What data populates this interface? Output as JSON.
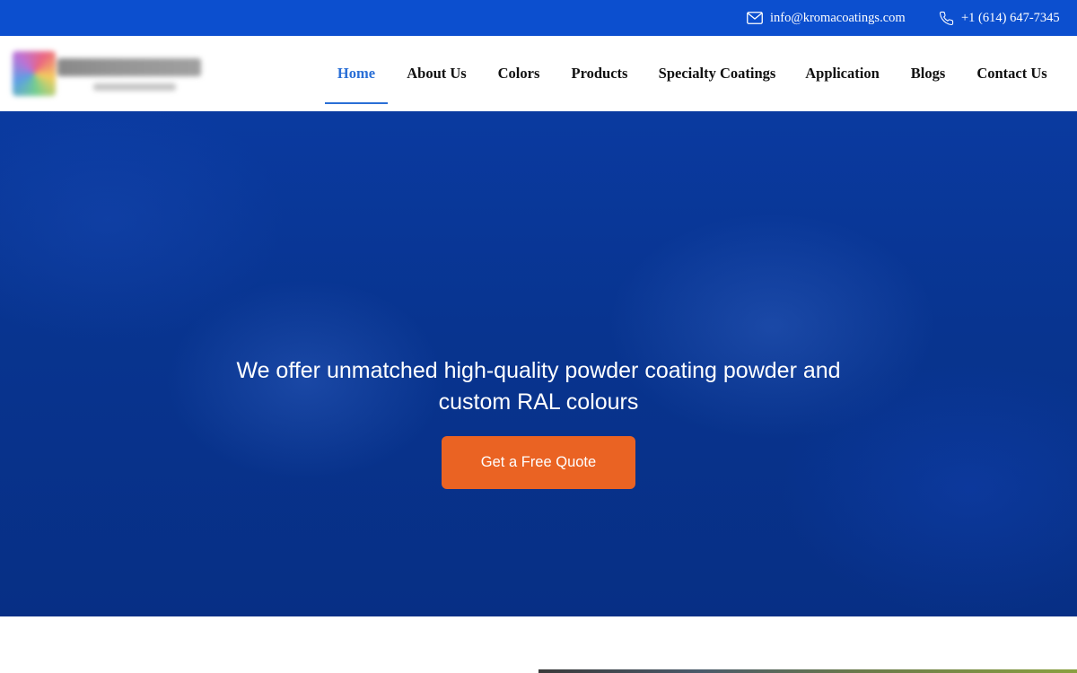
{
  "topbar": {
    "email": {
      "icon": "mail-icon",
      "text": "info@kromacoatings.com"
    },
    "phone": {
      "icon": "phone-icon",
      "text": "+1 (614) 647-7345"
    }
  },
  "header": {
    "logo": {
      "alt": "Kroma Coatings logo (blurred)"
    },
    "nav": [
      {
        "label": "Home",
        "active": true
      },
      {
        "label": "About Us",
        "active": false
      },
      {
        "label": "Colors",
        "active": false
      },
      {
        "label": "Products",
        "active": false
      },
      {
        "label": "Specialty Coatings",
        "active": false
      },
      {
        "label": "Application",
        "active": false
      },
      {
        "label": "Blogs",
        "active": false
      },
      {
        "label": "Contact Us",
        "active": false
      }
    ]
  },
  "hero": {
    "heading_line1": "We offer unmatched high-quality powder coating powder and",
    "heading_line2": "custom RAL colours",
    "cta_label": "Get a Free Quote"
  },
  "colors": {
    "topbar": "#0c4fcf",
    "nav_active": "#2a6fd6",
    "hero_bg": "#08348f",
    "cta": "#ea6323"
  }
}
